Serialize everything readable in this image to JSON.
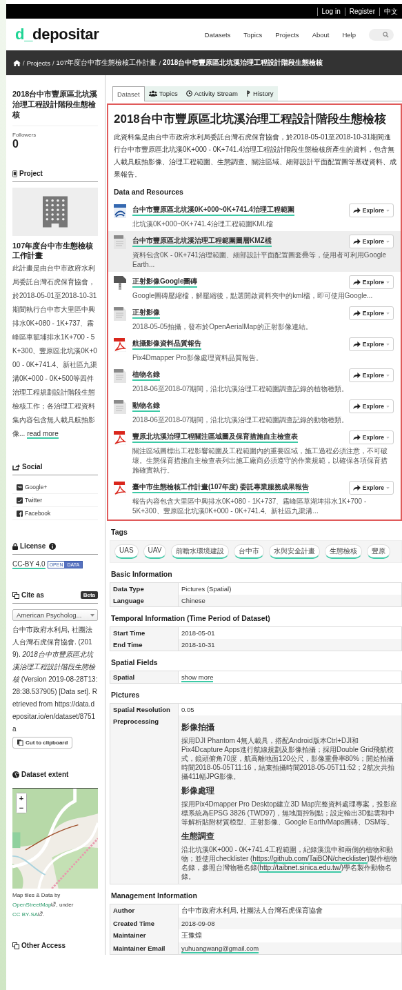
{
  "top_bar": {
    "links": [
      "Log in",
      "Register",
      "中文"
    ]
  },
  "header": {
    "logo": {
      "mark": "d_",
      "name": "depositar"
    },
    "nav": [
      "Datasets",
      "Topics",
      "Projects",
      "About",
      "Help"
    ]
  },
  "breadcrumb": [
    {
      "separator": "/",
      "label": "Projects",
      "current": false
    },
    {
      "separator": "/",
      "label": "107年度台中市生態檢核工作計畫",
      "current": false
    },
    {
      "separator": "/",
      "label": "2018台中市豐原區北坑溪治理工程設計階段生態檢核",
      "current": true
    }
  ],
  "sidebar": {
    "title": "2018台中市豐原區北坑溪治理工程設計階段生態檢核",
    "followers_label": "Followers",
    "followers_count": "0",
    "project": {
      "heading": "Project",
      "title": "107年度台中市生態檢核工作計畫",
      "description": "此計畫是由台中市政府水利局委託台灣石虎保育協會，於2018-05-01至2018-10-31期間執行台中市大里區中興排水0K+080 - 1K+737、霧峰區車籠埔排水1K+700 - 5K+300、豐原區北坑溪0K+000 - 0K+741.4、新社區九渠溝0K+000 - 0K+500等四件治理工程規劃設計階段生態檢核工作；各治理工程資料集內容包含無人載具航拍影像...",
      "read_more": "read more"
    },
    "social": {
      "heading": "Social",
      "items": [
        {
          "kind": "google",
          "label": "Google+"
        },
        {
          "kind": "twitter",
          "label": "Twitter"
        },
        {
          "kind": "facebook",
          "label": "Facebook"
        }
      ]
    },
    "license": {
      "heading": "License",
      "link": "CC-BY 4.0",
      "badge": [
        "OPEN",
        "DATA"
      ]
    },
    "cite": {
      "heading": "Cite as",
      "badge": "Beta",
      "style": "American Psycholog...",
      "citation": "台中市政府水利局, 社團法人台灣石虎保育協會. (2019). *2018台中市豐原區北坑溪治理工程設計階段生態檢核* (Version 2019-08-28T13:28:38.537905) [Data set]. Retrieved from https://data.depositar.io/en/dataset/8751a",
      "copy_button": "Cut to clipboard"
    },
    "extent": {
      "heading": "Dataset extent",
      "zoom_in": "+",
      "zoom_out": "−",
      "attribution": [
        {
          "text": "Map tiles & Data by "
        },
        {
          "link": "OpenStreetMap"
        },
        {
          "text": ", under "
        },
        {
          "link": "CC BY-SA"
        },
        {
          "text": "."
        }
      ]
    },
    "other_access": {
      "heading": "Other Access"
    }
  },
  "tabs": [
    {
      "kind": "dataset",
      "label": "Dataset",
      "selected": true
    },
    {
      "kind": "topics",
      "label": "Topics",
      "selected": false
    },
    {
      "kind": "activity",
      "label": "Activity Stream",
      "selected": false
    },
    {
      "kind": "history",
      "label": "History",
      "selected": false
    }
  ],
  "dataset": {
    "title": "2018台中市豐原區北坑溪治理工程設計階段生態檢核",
    "description": "此資料集是由台中市政府水利局委託台灣石虎保育協會，於2018-05-01至2018-10-31期間進行台中市豐原區北坑溪0K+000 - 0K+741.4治理工程設計階段生態檢核所產生的資料，包含無人載具航拍影像、治理工程範圍、生態調查、關注區域、細部設計平面配置圖等基礎資料、成果報告。",
    "resources_heading": "Data and Resources",
    "resources": [
      {
        "kind": "kml",
        "title": "台中市豐原區北坑溪0K+000~0K+741.4治理工程範圍",
        "description": "北坑溪0K+000~0K+741.4治理工程範圍KML檔",
        "highlighted": false,
        "action": "Explore"
      },
      {
        "kind": "data",
        "title": "台中市豐原區北坑溪治理工程範圍圖層KMZ檔",
        "description": "資料包含0K - 0K+741治理範圍、細部設計平面配置圖套疊等，使用者可利用Google Earth...",
        "highlighted": true,
        "action": "Explore"
      },
      {
        "kind": "zip",
        "title": "正射影像Google圖磚",
        "description": "Google圖磚壓縮檔，解壓縮後，點選開啟資料夾中的kml檔，即可使用Google...",
        "highlighted": false,
        "action": "Explore"
      },
      {
        "kind": "data",
        "title": "正射影像",
        "description": "2018-05-05拍攝，發布於OpenAerialMap的正射影像連結。",
        "highlighted": false,
        "action": "Explore"
      },
      {
        "kind": "pdf",
        "title": "航攝影像資料品質報告",
        "description": "Pix4Dmapper Pro影像處理資料品質報告。",
        "highlighted": false,
        "action": "Explore"
      },
      {
        "kind": "data",
        "title": "植物名錄",
        "description": "2018-06至2018-07期間，沿北坑溪治理工程範圍調查記錄的植物種類。",
        "highlighted": false,
        "action": "Explore"
      },
      {
        "kind": "data",
        "title": "動物名錄",
        "description": "2018-06至2018-07期間，沿北坑溪治理工程範圍調查記錄的動物種類。",
        "highlighted": false,
        "action": "Explore"
      },
      {
        "kind": "pdf",
        "title": "豐原北坑溪治理工程關注區域圖及保育措施自主檢查表",
        "description": "關注區域圖標出工程影響範圍及工程範圍內的重要區域，施工過程必須注意，不可破壞。生態保育措施自主檢查表列出施工廠商必須遵守的作業規範，以確保各項保育措施確實執行。",
        "highlighted": false,
        "action": "Explore"
      },
      {
        "kind": "pdf",
        "title": "臺中市生態檢核工作計畫(107年度) 委託專業服務成果報告",
        "description": "報告內容包含大里區中興排水0K+080 - 1K+737、霧峰區草湖埤排水1K+700 - 5K+300、豐原區北坑溪0K+000 - 0K+741.4、新社區九渠溝...",
        "highlighted": false,
        "action": "Explore"
      }
    ]
  },
  "tags": {
    "heading": "Tags",
    "items": [
      "UAS",
      "UAV",
      "前瞻水環境建設",
      "台中市",
      "水與安全計畫",
      "生態檢核",
      "豐原"
    ]
  },
  "sections": [
    {
      "heading": "Basic Information",
      "rows": [
        {
          "label": "Data Type",
          "kind": "text",
          "value": "Pictures (Spatial)"
        },
        {
          "label": "Language",
          "kind": "text",
          "value": "Chinese"
        }
      ]
    },
    {
      "heading": "Temporal Information (Time Period of Dataset)",
      "rows": [
        {
          "label": "Start Time",
          "kind": "text",
          "value": "2018-05-01"
        },
        {
          "label": "End Time",
          "kind": "text",
          "value": "2018-10-31"
        }
      ]
    },
    {
      "heading": "Spatial Fields",
      "rows": [
        {
          "label": "Spatial",
          "kind": "link",
          "value": "show more"
        }
      ]
    },
    {
      "heading": "Pictures",
      "rows": [
        {
          "label": "Spatial Resolution",
          "kind": "text",
          "value": "0.05"
        },
        {
          "label": "Preprocessing",
          "kind": "blocks",
          "blocks": [
            {
              "heading": "影像拍攝",
              "segments": [
                {
                  "text": "採用DJI Phantom 4無人載具，搭配Android版本Ctrl+DJI和Pix4Dcapture Apps進行航線規劃及影像拍攝；採用Double Grid飛航模式，鏡頭俯角70度，航高離地面120公尺，影像重疊率80%；開始拍攝時間2018-05-05T11:16，結束拍攝時間2018-05-05T11:52；2航次共拍攝411幅JPG影像。"
                }
              ]
            },
            {
              "heading": "影像處理",
              "segments": [
                {
                  "text": "採用Pix4Dmapper Pro Desktop建立3D Map完整資料處理專案，投影座標系統為EPSG 3826 (TWD97)，無地面控制點；設定輸出3D點雲和中等解析貼附材質模型、正射影像、Google Earth/Maps圖磚、DSM等。"
                }
              ]
            },
            {
              "heading": "生態調查",
              "segments": [
                {
                  "text": "沿北坑溪0K+000 - 0K+741.4工程範圍，紀錄溪流中和兩側的植物和動物；並使用checklister ("
                },
                {
                  "link": "https://github.com/TaiBON/checklister"
                },
                {
                  "text": ")製作植物名錄，參照台灣物種名錄("
                },
                {
                  "link": "http://taibnet.sinica.edu.tw/"
                },
                {
                  "text": ")學名製作動物名錄。"
                }
              ]
            }
          ]
        }
      ]
    },
    {
      "heading": "Management Information",
      "rows": [
        {
          "label": "Author",
          "kind": "text",
          "value": "台中市政府水利局, 社團法人台灣石虎保育協會"
        },
        {
          "label": "Created Time",
          "kind": "text",
          "value": "2018-09-08"
        },
        {
          "label": "Maintainer",
          "kind": "text",
          "value": "王豫煌"
        },
        {
          "label": "Maintainer Email",
          "kind": "link",
          "value": "yuhuangwang@gmail.com"
        }
      ]
    }
  ]
}
